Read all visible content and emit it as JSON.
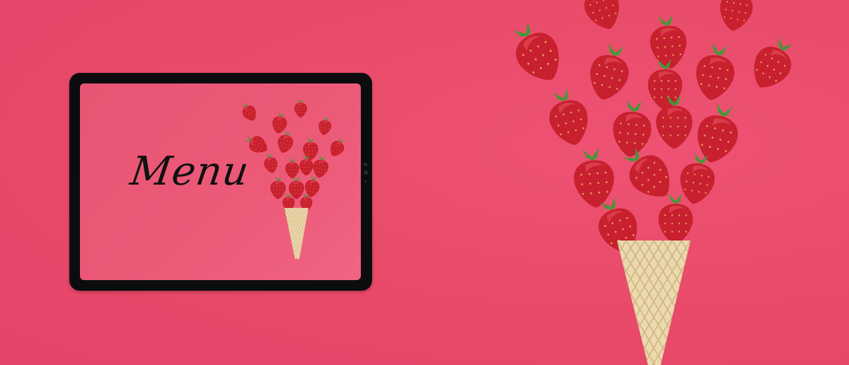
{
  "tablet": {
    "screen_title": "Menu"
  },
  "colors": {
    "background": "#e94a69",
    "strawberry": "#c8202e",
    "leaf": "#3f9a35",
    "cone": "#ecd9ad",
    "bezel": "#0c0c0e"
  }
}
